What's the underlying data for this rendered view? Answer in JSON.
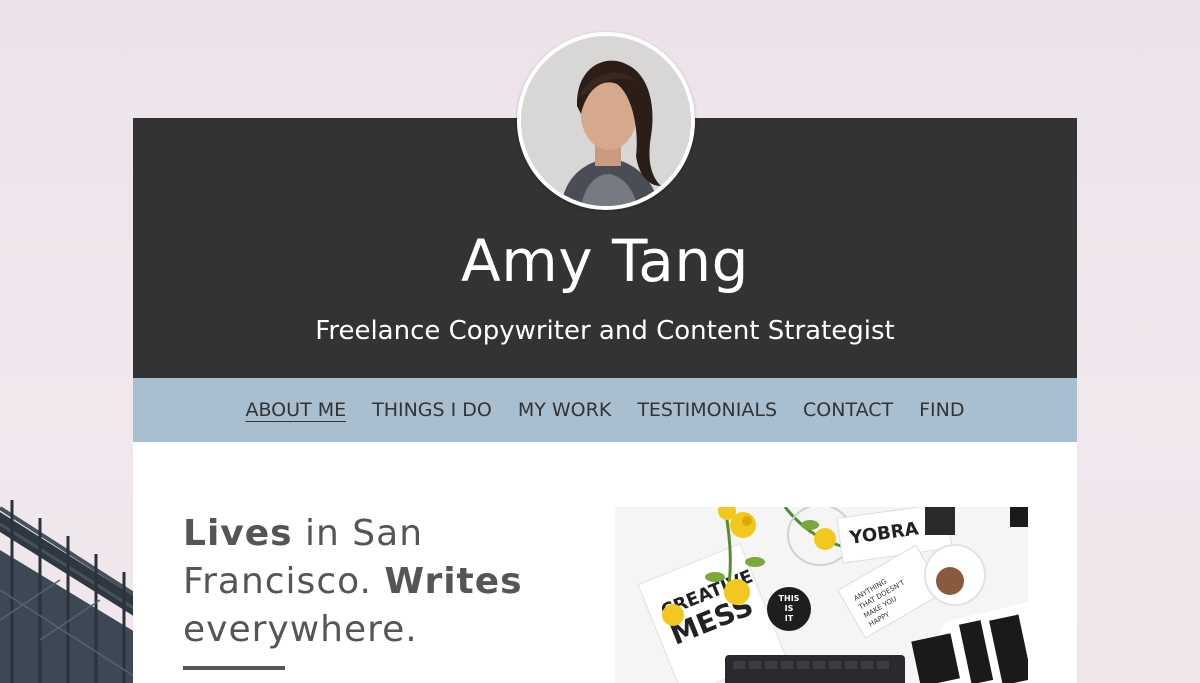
{
  "profile": {
    "name": "Amy Tang",
    "tagline": "Freelance Copywriter and Content Strategist"
  },
  "nav": {
    "items": [
      {
        "label": "ABOUT ME",
        "active": true
      },
      {
        "label": "THINGS I DO",
        "active": false
      },
      {
        "label": "MY WORK",
        "active": false
      },
      {
        "label": "TESTIMONIALS",
        "active": false
      },
      {
        "label": "CONTACT",
        "active": false
      },
      {
        "label": "FIND",
        "active": false
      }
    ]
  },
  "hero": {
    "part1_bold": "Lives",
    "part2": " in San Francisco. ",
    "part3_bold": "Writes",
    "part4": " everywhere."
  },
  "desk_photo": {
    "word_creative": "CREATIVE",
    "word_mess": "MESS",
    "word_this": "THIS",
    "word_is": "IS",
    "word_it": "IT",
    "word_yobra": "YOBRA",
    "word_anything": "ANYTHING",
    "word_that_doesnt": "THAT DOESN'T",
    "word_make_you": "MAKE YOU",
    "word_happy": "HAPPY"
  },
  "colors": {
    "header_bg": "#333333",
    "nav_bg": "#a9bfcf",
    "page_bg": "#ede2ea",
    "text_dark": "#555555"
  }
}
